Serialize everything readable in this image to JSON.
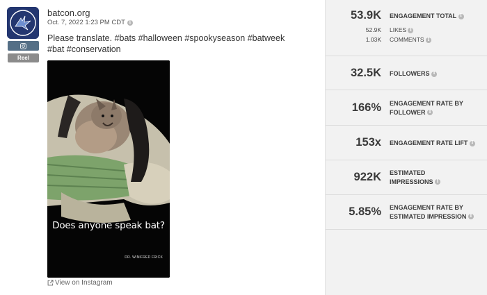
{
  "post": {
    "account": "batcon.org",
    "date": "Oct. 7, 2022 1:23 PM CDT",
    "caption": "Please translate. #bats #halloween #spookyseason #batweek #bat #conservation",
    "badge_reel": "Reel",
    "media_overlay_text": "Does anyone speak bat?",
    "media_credit": "DR. WINIFRED FRICK",
    "view_link": "View on Instagram",
    "icons": [
      "bat-logo-icon",
      "instagram-icon",
      "external-link-icon",
      "info-icon"
    ]
  },
  "metrics": {
    "engagement_total": {
      "value": "53.9K",
      "label": "ENGAGEMENT TOTAL"
    },
    "likes": {
      "value": "52.9K",
      "label": "LIKES"
    },
    "comments": {
      "value": "1.03K",
      "label": "COMMENTS"
    },
    "followers": {
      "value": "32.5K",
      "label": "FOLLOWERS"
    },
    "engagement_rate_follower": {
      "value": "166%",
      "label1": "ENGAGEMENT RATE BY",
      "label2": "FOLLOWER"
    },
    "engagement_rate_lift": {
      "value": "153x",
      "label": "ENGAGEMENT RATE LIFT"
    },
    "estimated_impressions": {
      "value": "922K",
      "label1": "ESTIMATED",
      "label2": "IMPRESSIONS"
    },
    "engagement_rate_impression": {
      "value": "5.85%",
      "label1": "ENGAGEMENT RATE BY",
      "label2": "ESTIMATED IMPRESSION"
    }
  },
  "colors": {
    "avatar_bg": "#233670",
    "instagram_badge": "#546f86",
    "reel_badge": "#8b8b8b",
    "panel_bg": "#f2f2f2"
  }
}
